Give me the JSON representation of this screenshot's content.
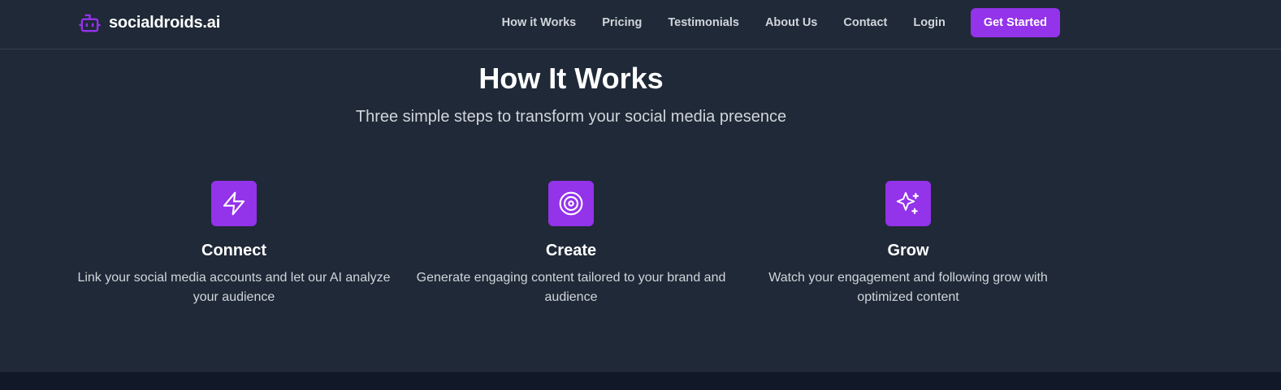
{
  "brand": {
    "name": "socialdroids.ai",
    "icon": "bot-icon",
    "accent_color": "#9333ea"
  },
  "nav": {
    "links": [
      "How it Works",
      "Pricing",
      "Testimonials",
      "About Us",
      "Contact",
      "Login"
    ],
    "cta_label": "Get Started"
  },
  "section": {
    "title": "How It Works",
    "subtitle": "Three simple steps to transform your social media presence"
  },
  "steps": [
    {
      "icon": "zap-icon",
      "title": "Connect",
      "description": "Link your social media accounts and let our AI analyze your audience"
    },
    {
      "icon": "target-icon",
      "title": "Create",
      "description": "Generate engaging content tailored to your brand and audience"
    },
    {
      "icon": "sparkles-icon",
      "title": "Grow",
      "description": "Watch your engagement and following grow with optimized content"
    }
  ],
  "colors": {
    "background": "#1f2937",
    "footer": "#111827",
    "accent": "#9333ea"
  }
}
